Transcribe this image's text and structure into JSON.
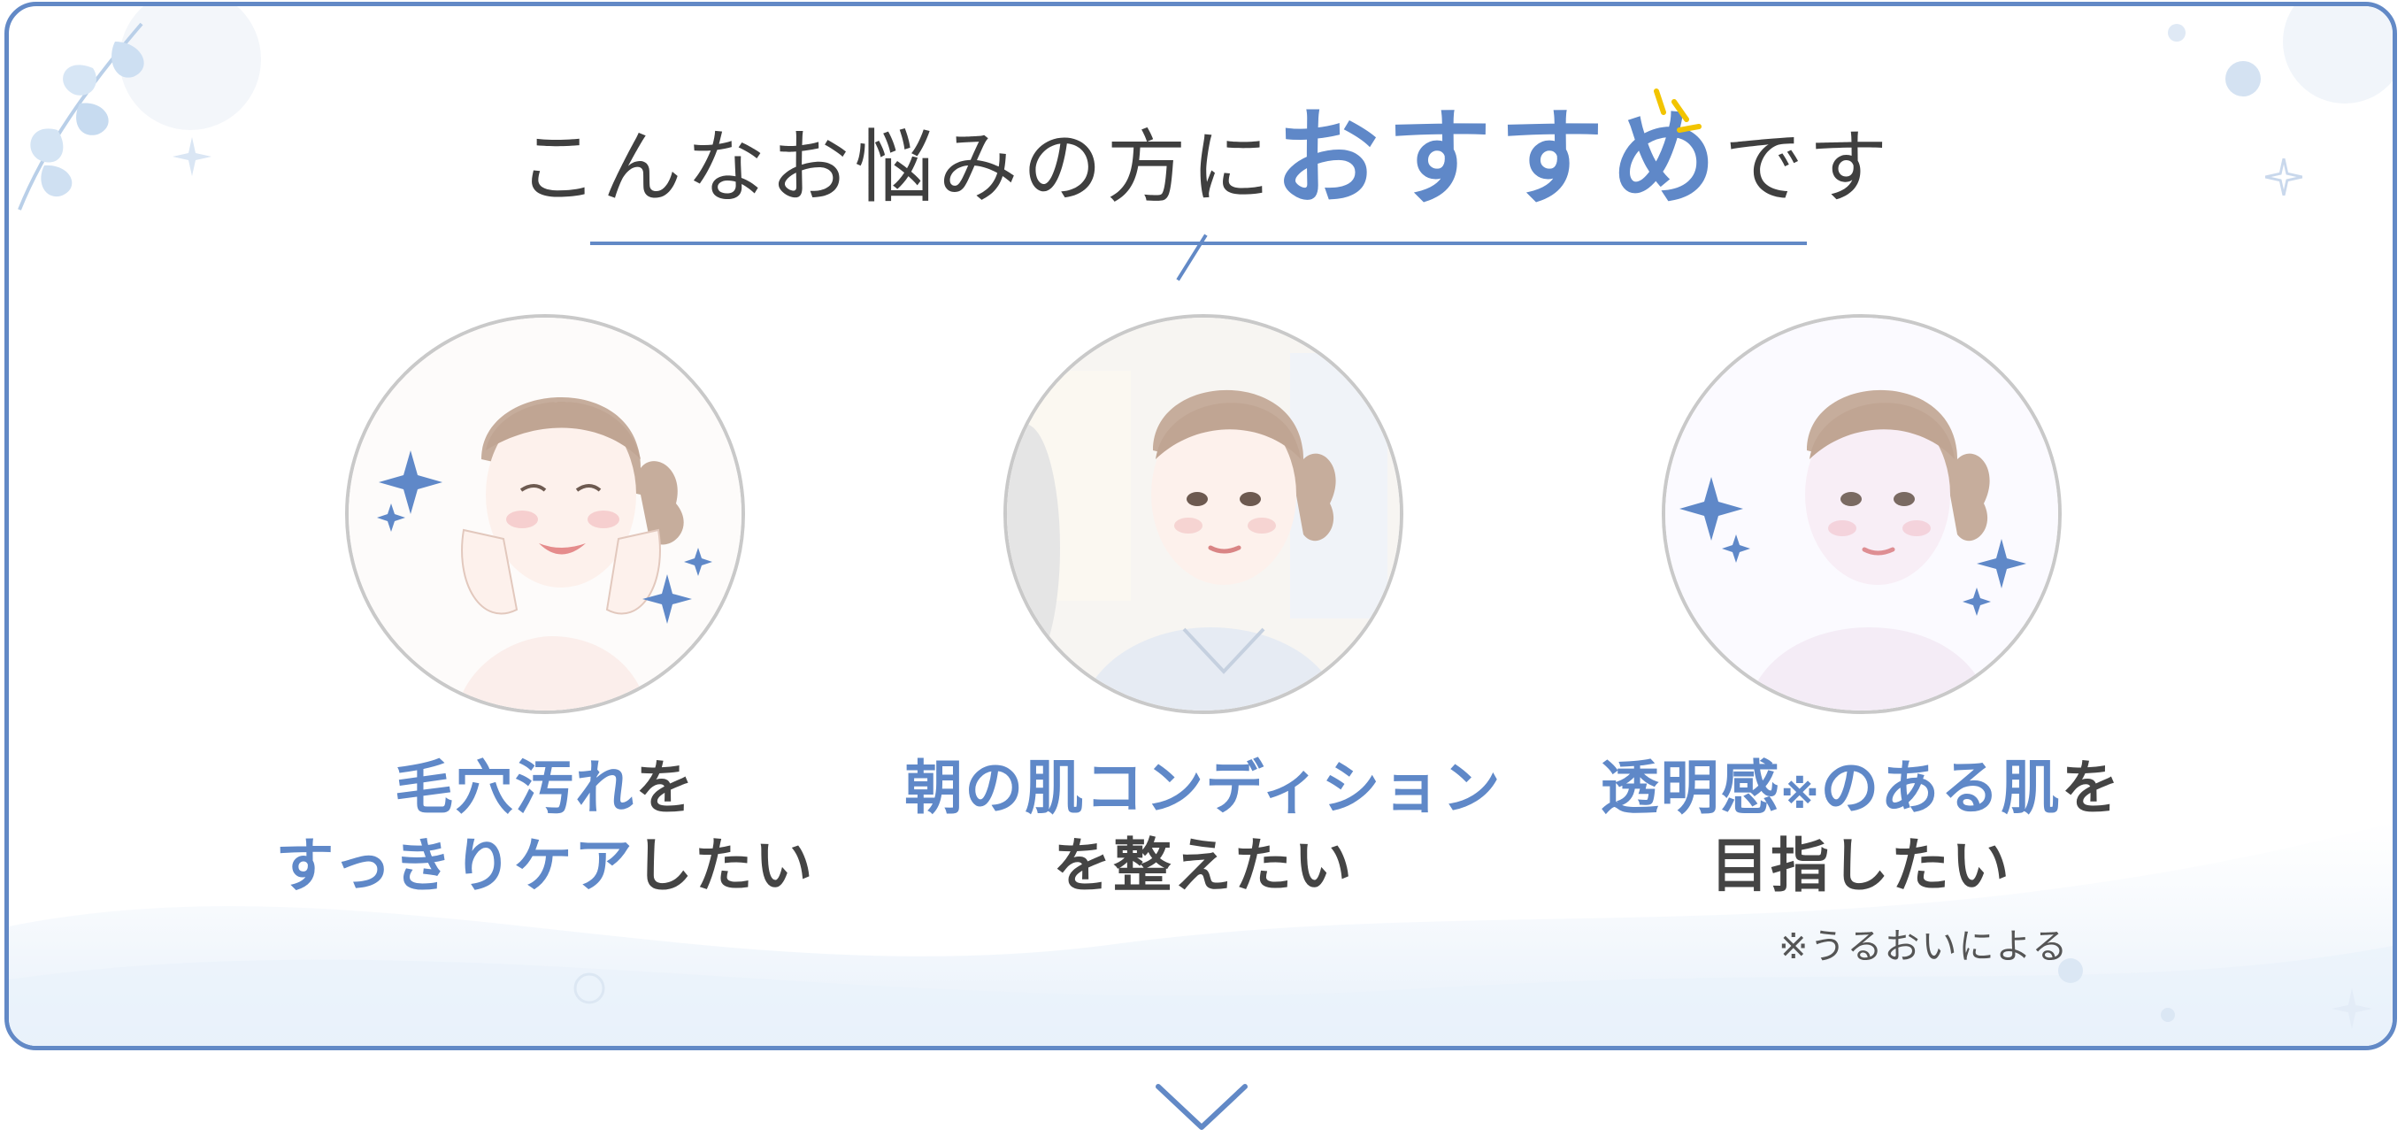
{
  "colors": {
    "accent": "#5f88c8",
    "frame": "#6289c6",
    "text": "#444444",
    "sparkle": "#f2c400"
  },
  "header": {
    "title_prefix": "こんなお悩みの方に",
    "title_accent": "おすすめ",
    "title_suffix": "です"
  },
  "items": [
    {
      "portrait_icon": "smiling-woman-illustration",
      "line1_accent": "毛穴汚れ",
      "line1_plain": "を",
      "line2_accent": "すっきりケア",
      "line2_plain": "したい"
    },
    {
      "portrait_icon": "woman-at-mirror-illustration",
      "line1_accent": "朝の肌コンディション",
      "line1_plain": "",
      "line2_accent": "",
      "line2_plain": "を整えたい"
    },
    {
      "portrait_icon": "radiant-woman-illustration",
      "line1_accent": "透明感",
      "line1_mark": "※",
      "line1_accent_b": "のある肌",
      "line1_plain": "を",
      "line2_accent": "",
      "line2_plain": "目指したい"
    }
  ],
  "footnote": "※うるおいによる",
  "icons": {
    "next": "chevron-down-icon",
    "leaf": "leaf-icon",
    "sparkle": "sparkle-icon"
  }
}
